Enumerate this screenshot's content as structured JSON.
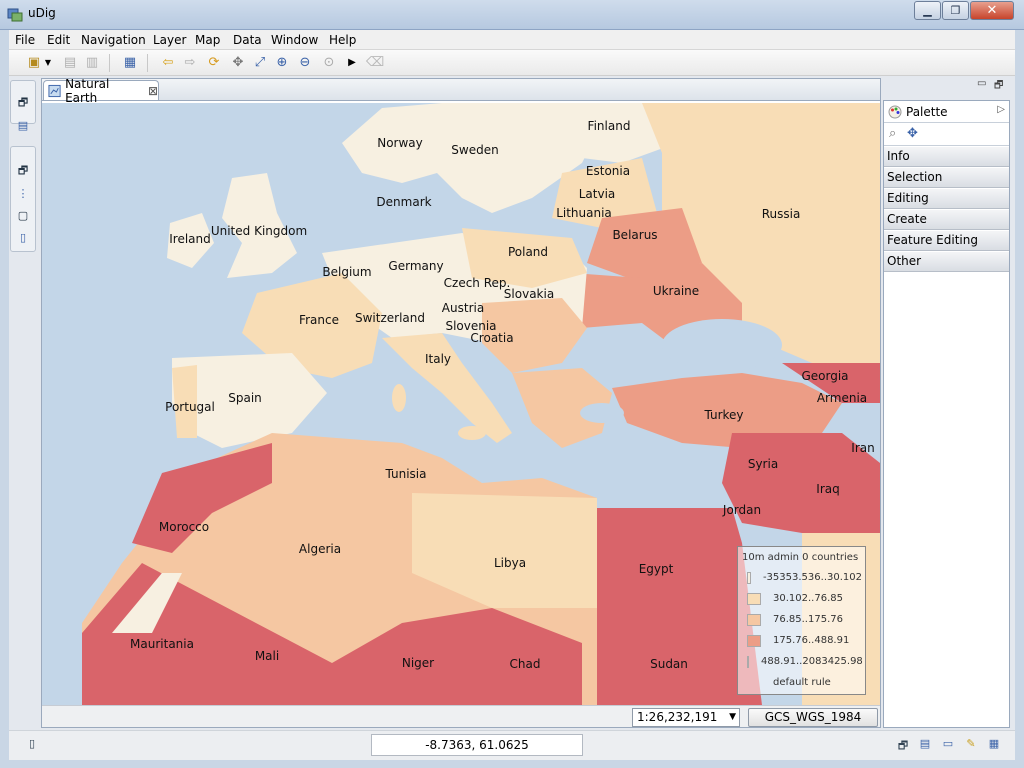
{
  "window": {
    "title": "uDig"
  },
  "menu": [
    "File",
    "Edit",
    "Navigation",
    "Layer",
    "Map",
    "Data",
    "Window",
    "Help"
  ],
  "editor_tab": {
    "label": "Natural Earth",
    "close_glyph": "⊠"
  },
  "palette": {
    "title": "Palette",
    "drawers": [
      "Info",
      "Selection",
      "Editing",
      "Create",
      "Feature Editing",
      "Other"
    ]
  },
  "map": {
    "countries": [
      "Finland",
      "Norway",
      "Sweden",
      "Estonia",
      "Latvia",
      "Lithuania",
      "Denmark",
      "Russia",
      "Belarus",
      "Ireland",
      "United Kingdom",
      "Poland",
      "Germany",
      "Belgium",
      "Czech Rep.",
      "Slovakia",
      "Ukraine",
      "Austria",
      "France",
      "Switzerland",
      "Slovenia",
      "Croatia",
      "Italy",
      "Georgia",
      "Armenia",
      "Spain",
      "Portugal",
      "Turkey",
      "Iran",
      "Syria",
      "Iraq",
      "Tunisia",
      "Jordan",
      "Morocco",
      "Algeria",
      "Libya",
      "Egypt",
      "Mauritania",
      "Mali",
      "Niger",
      "Chad",
      "Sudan"
    ]
  },
  "legend": {
    "title": "10m admin 0 countries",
    "items": [
      {
        "label": "-35353.536..30.102",
        "color": "#f7f0e1"
      },
      {
        "label": "30.102..76.85",
        "color": "#f8ddb6"
      },
      {
        "label": "76.85..175.76",
        "color": "#f5c7a2"
      },
      {
        "label": "175.76..488.91",
        "color": "#ec9d86"
      },
      {
        "label": "488.91..2083425.98",
        "color": "#d9646a"
      },
      {
        "label": "default rule",
        "color": ""
      }
    ]
  },
  "map_status": {
    "scale": "1:26,232,191",
    "crs": "GCS_WGS_1984"
  },
  "status": {
    "coordinates": "-8.7363, 61.0625"
  },
  "colors": {
    "water": "#c3d6e8",
    "land_low": "#f7f0e1",
    "land_mid": "#f8ddb6",
    "land_high": "#ec9d86",
    "land_top": "#d9646a"
  }
}
